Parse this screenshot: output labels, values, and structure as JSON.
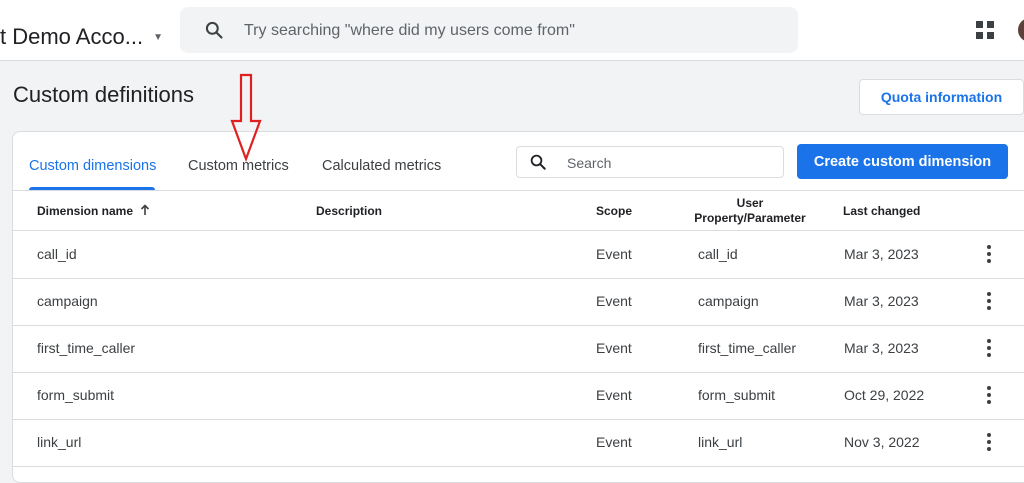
{
  "topbar": {
    "account_name": "t Demo Acco...",
    "search_placeholder": "Try searching \"where did my users come from\""
  },
  "page": {
    "title": "Custom definitions",
    "quota_button": "Quota information"
  },
  "tabs": [
    {
      "label": "Custom dimensions",
      "active": true
    },
    {
      "label": "Custom metrics",
      "active": false
    },
    {
      "label": "Calculated metrics",
      "active": false
    }
  ],
  "table_search": {
    "placeholder": "Search"
  },
  "create_button": "Create custom dimension",
  "columns": {
    "dimension_name": "Dimension name",
    "description": "Description",
    "scope": "Scope",
    "user_property_line1": "User",
    "user_property_line2": "Property/Parameter",
    "last_changed": "Last changed"
  },
  "rows": [
    {
      "name": "call_id",
      "description": "",
      "scope": "Event",
      "parameter": "call_id",
      "last_changed": "Mar 3, 2023"
    },
    {
      "name": "campaign",
      "description": "",
      "scope": "Event",
      "parameter": "campaign",
      "last_changed": "Mar 3, 2023"
    },
    {
      "name": "first_time_caller",
      "description": "",
      "scope": "Event",
      "parameter": "first_time_caller",
      "last_changed": "Mar 3, 2023"
    },
    {
      "name": "form_submit",
      "description": "",
      "scope": "Event",
      "parameter": "form_submit",
      "last_changed": "Oct 29, 2022"
    },
    {
      "name": "link_url",
      "description": "",
      "scope": "Event",
      "parameter": "link_url",
      "last_changed": "Nov 3, 2022"
    }
  ],
  "icons": {
    "search": "search-icon",
    "apps": "apps-grid-icon",
    "sort": "arrow-up-icon",
    "more": "more-vert-icon",
    "annotation": "red-down-arrow-annotation"
  },
  "colors": {
    "accent": "#1a73e8",
    "annotation": "#e02020"
  }
}
